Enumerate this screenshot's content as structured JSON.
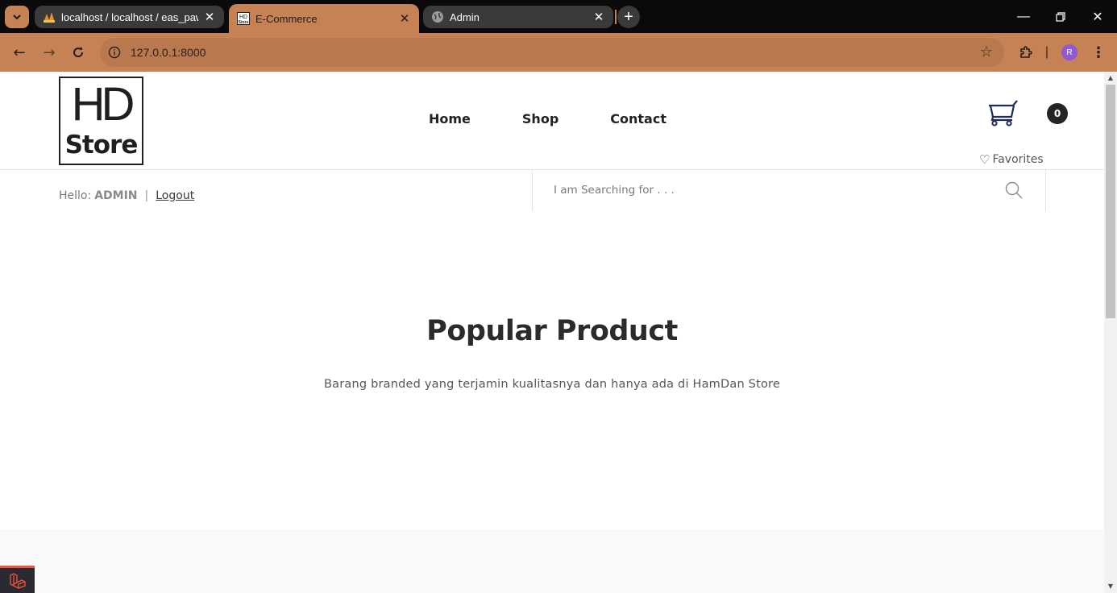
{
  "browser": {
    "tabs": [
      {
        "title": "localhost / localhost / eas_paw |",
        "favicon": "phpmyadmin-icon",
        "active": false
      },
      {
        "title": "E-Commerce",
        "favicon": "hd-store-favicon",
        "active": true
      },
      {
        "title": "Admin",
        "favicon": "globe-icon",
        "active": false
      }
    ],
    "url": "127.0.0.1:8000",
    "profile_initial": "R",
    "accent": "#c68154"
  },
  "site": {
    "logo": {
      "top": "HD",
      "bottom": "Store"
    },
    "nav": [
      "Home",
      "Shop",
      "Contact"
    ],
    "cart_count": "0",
    "favorites_label": "Favorites",
    "greeting": {
      "hello": "Hello:",
      "user": "ADMIN",
      "separator": "|",
      "logout": "Logout"
    },
    "search": {
      "placeholder": "I am Searching for . . ."
    },
    "section": {
      "title": "Popular Product",
      "subtitle": "Barang branded yang terjamin kualitasnya dan hanya ada di HamDan Store"
    }
  }
}
